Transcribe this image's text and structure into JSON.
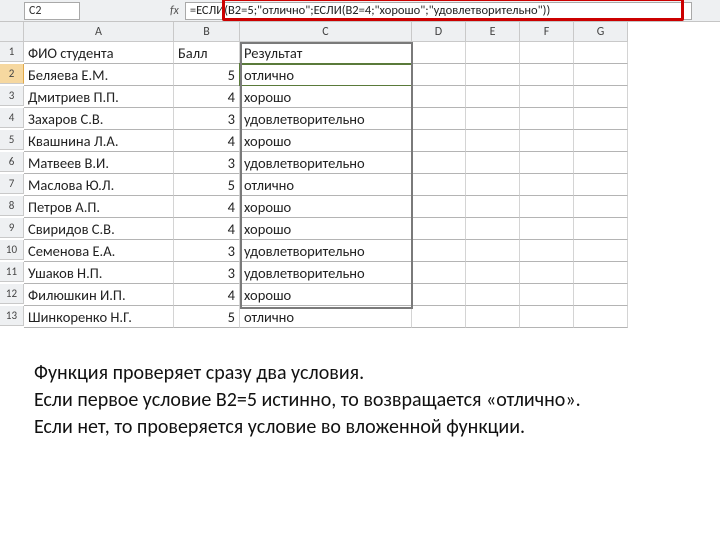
{
  "namebox": "C2",
  "fx": "fx",
  "formula": "=ЕСЛИ(B2=5;\"отлично\";ЕСЛИ(B2=4;\"хорошо\";\"удовлетворительно\"))",
  "columns": [
    "A",
    "B",
    "C",
    "D",
    "E",
    "F",
    "G"
  ],
  "header_row": [
    "ФИО студента",
    "Балл",
    "Результат",
    "",
    "",
    "",
    ""
  ],
  "rows": [
    {
      "n": "1",
      "a": "ФИО студента",
      "b": "Балл",
      "c": "Результат"
    },
    {
      "n": "2",
      "a": "Беляева Е.М.",
      "b": "5",
      "c": "отлично",
      "sel": true
    },
    {
      "n": "3",
      "a": "Дмитриев П.П.",
      "b": "4",
      "c": "хорошо"
    },
    {
      "n": "4",
      "a": "Захаров С.В.",
      "b": "3",
      "c": "удовлетворительно"
    },
    {
      "n": "5",
      "a": "Квашнина Л.А.",
      "b": "4",
      "c": "хорошо"
    },
    {
      "n": "6",
      "a": "Матвеев В.И.",
      "b": "3",
      "c": "удовлетворительно"
    },
    {
      "n": "7",
      "a": "Маслова Ю.Л.",
      "b": "5",
      "c": "отлично"
    },
    {
      "n": "8",
      "a": "Петров А.П.",
      "b": "4",
      "c": "хорошо"
    },
    {
      "n": "9",
      "a": "Свиридов С.В.",
      "b": "4",
      "c": "хорошо"
    },
    {
      "n": "10",
      "a": "Семенова Е.А.",
      "b": "3",
      "c": "удовлетворительно"
    },
    {
      "n": "11",
      "a": "Ушаков Н.П.",
      "b": "3",
      "c": "удовлетворительно"
    },
    {
      "n": "12",
      "a": "Филюшкин И.П.",
      "b": "4",
      "c": "хорошо"
    },
    {
      "n": "13",
      "a": "Шинкоренко Н.Г.",
      "b": "5",
      "c": "отлично"
    }
  ],
  "caption": {
    "l1": "Функция проверяет сразу два условия.",
    "l2": "Если первое условие В2=5  истинно, то  возвращается «отлично».",
    "l3": "Если нет, то проверяется условие во вложенной функции."
  }
}
